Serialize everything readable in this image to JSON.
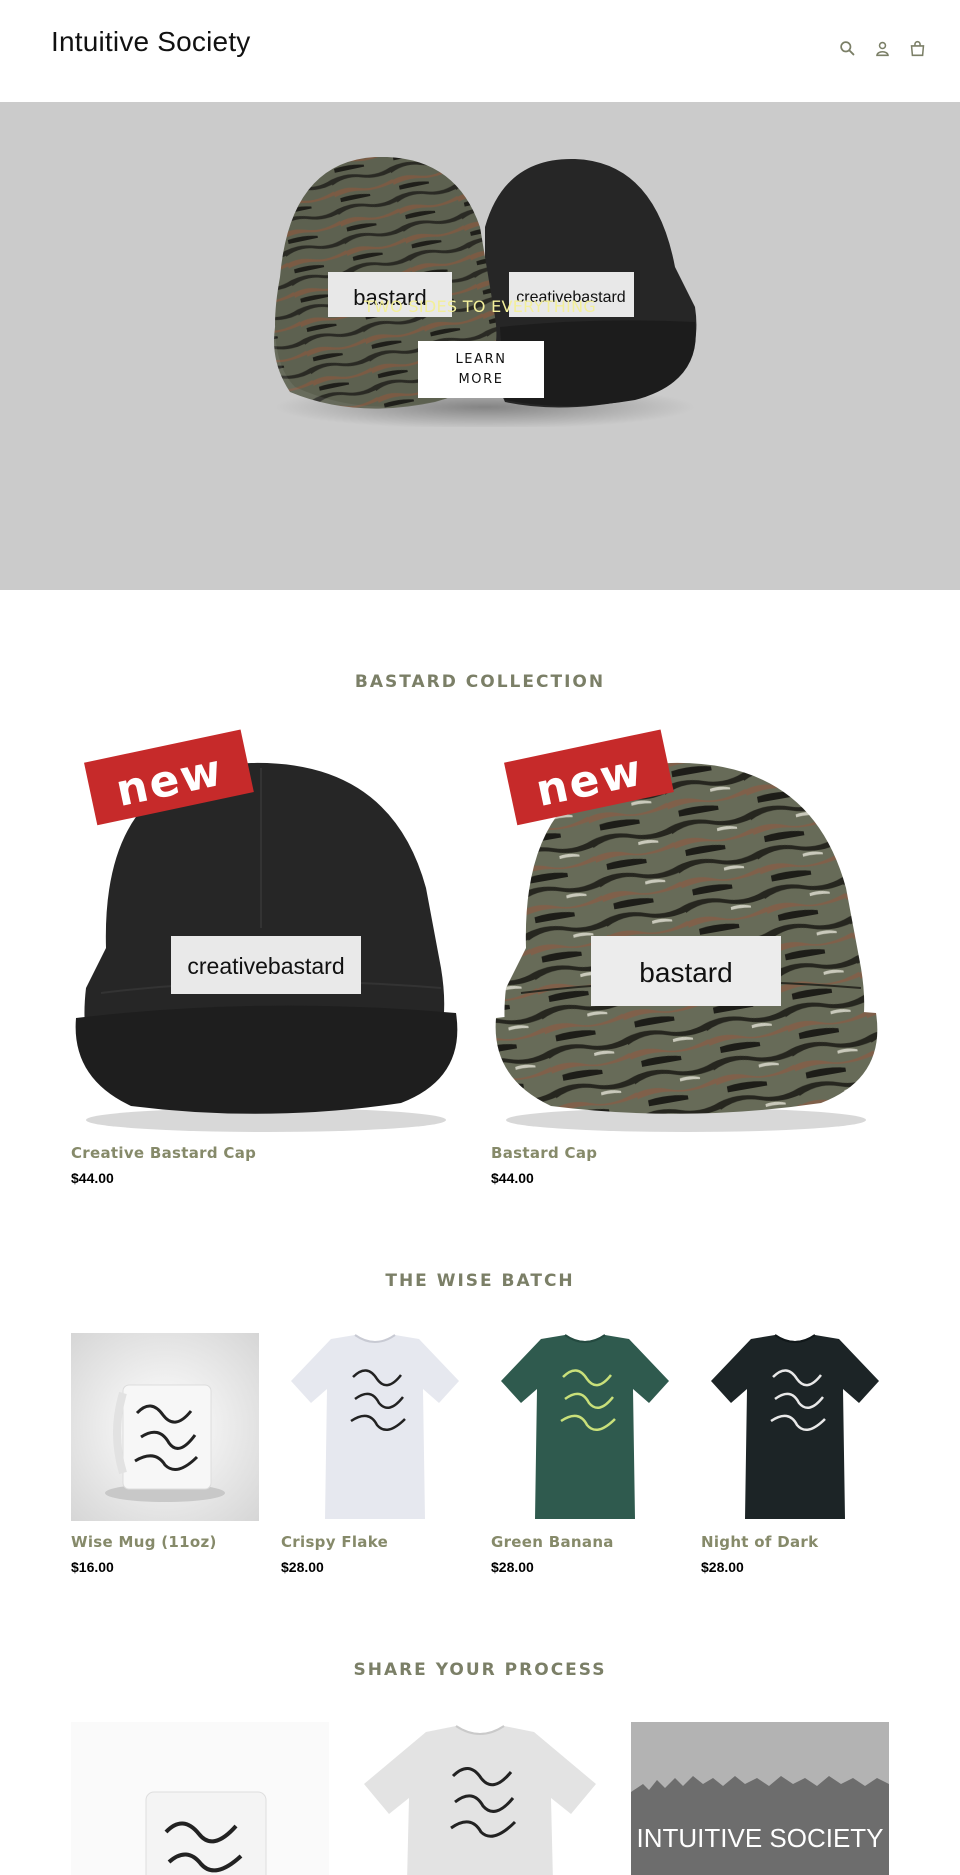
{
  "header": {
    "logo": "Intuitive Society"
  },
  "hero": {
    "title": "TWO SIDES TO EVERYTHING",
    "button_label": "LEARN MORE",
    "cap_patch_left": "bastard",
    "cap_patch_right": "creativebastard"
  },
  "sections": [
    {
      "title": "BASTARD COLLECTION",
      "products": [
        {
          "name": "Creative Bastard Cap",
          "price": "$44.00",
          "badge": "new",
          "patch": "creativebastard"
        },
        {
          "name": "Bastard Cap",
          "price": "$44.00",
          "badge": "new",
          "patch": "bastard"
        }
      ]
    },
    {
      "title": "THE WISE BATCH",
      "products": [
        {
          "name": "Wise Mug (11oz)",
          "price": "$16.00"
        },
        {
          "name": "Crispy Flake",
          "price": "$28.00"
        },
        {
          "name": "Green Banana",
          "price": "$28.00"
        },
        {
          "name": "Night of Dark",
          "price": "$28.00"
        }
      ]
    },
    {
      "title": "SHARE YOUR PROCESS",
      "gallery": [
        {
          "alt": "mug"
        },
        {
          "alt": "t-shirt"
        },
        {
          "caption": "INTUITIVE SOCIETY"
        }
      ]
    }
  ],
  "icons": [
    "search-icon",
    "account-icon",
    "cart-icon"
  ],
  "colors": {
    "hero_bg": "#cbcbcb",
    "accent_text": "#868a6a",
    "badge_red": "#c62a2a",
    "hero_title": "#f3ef9a"
  }
}
